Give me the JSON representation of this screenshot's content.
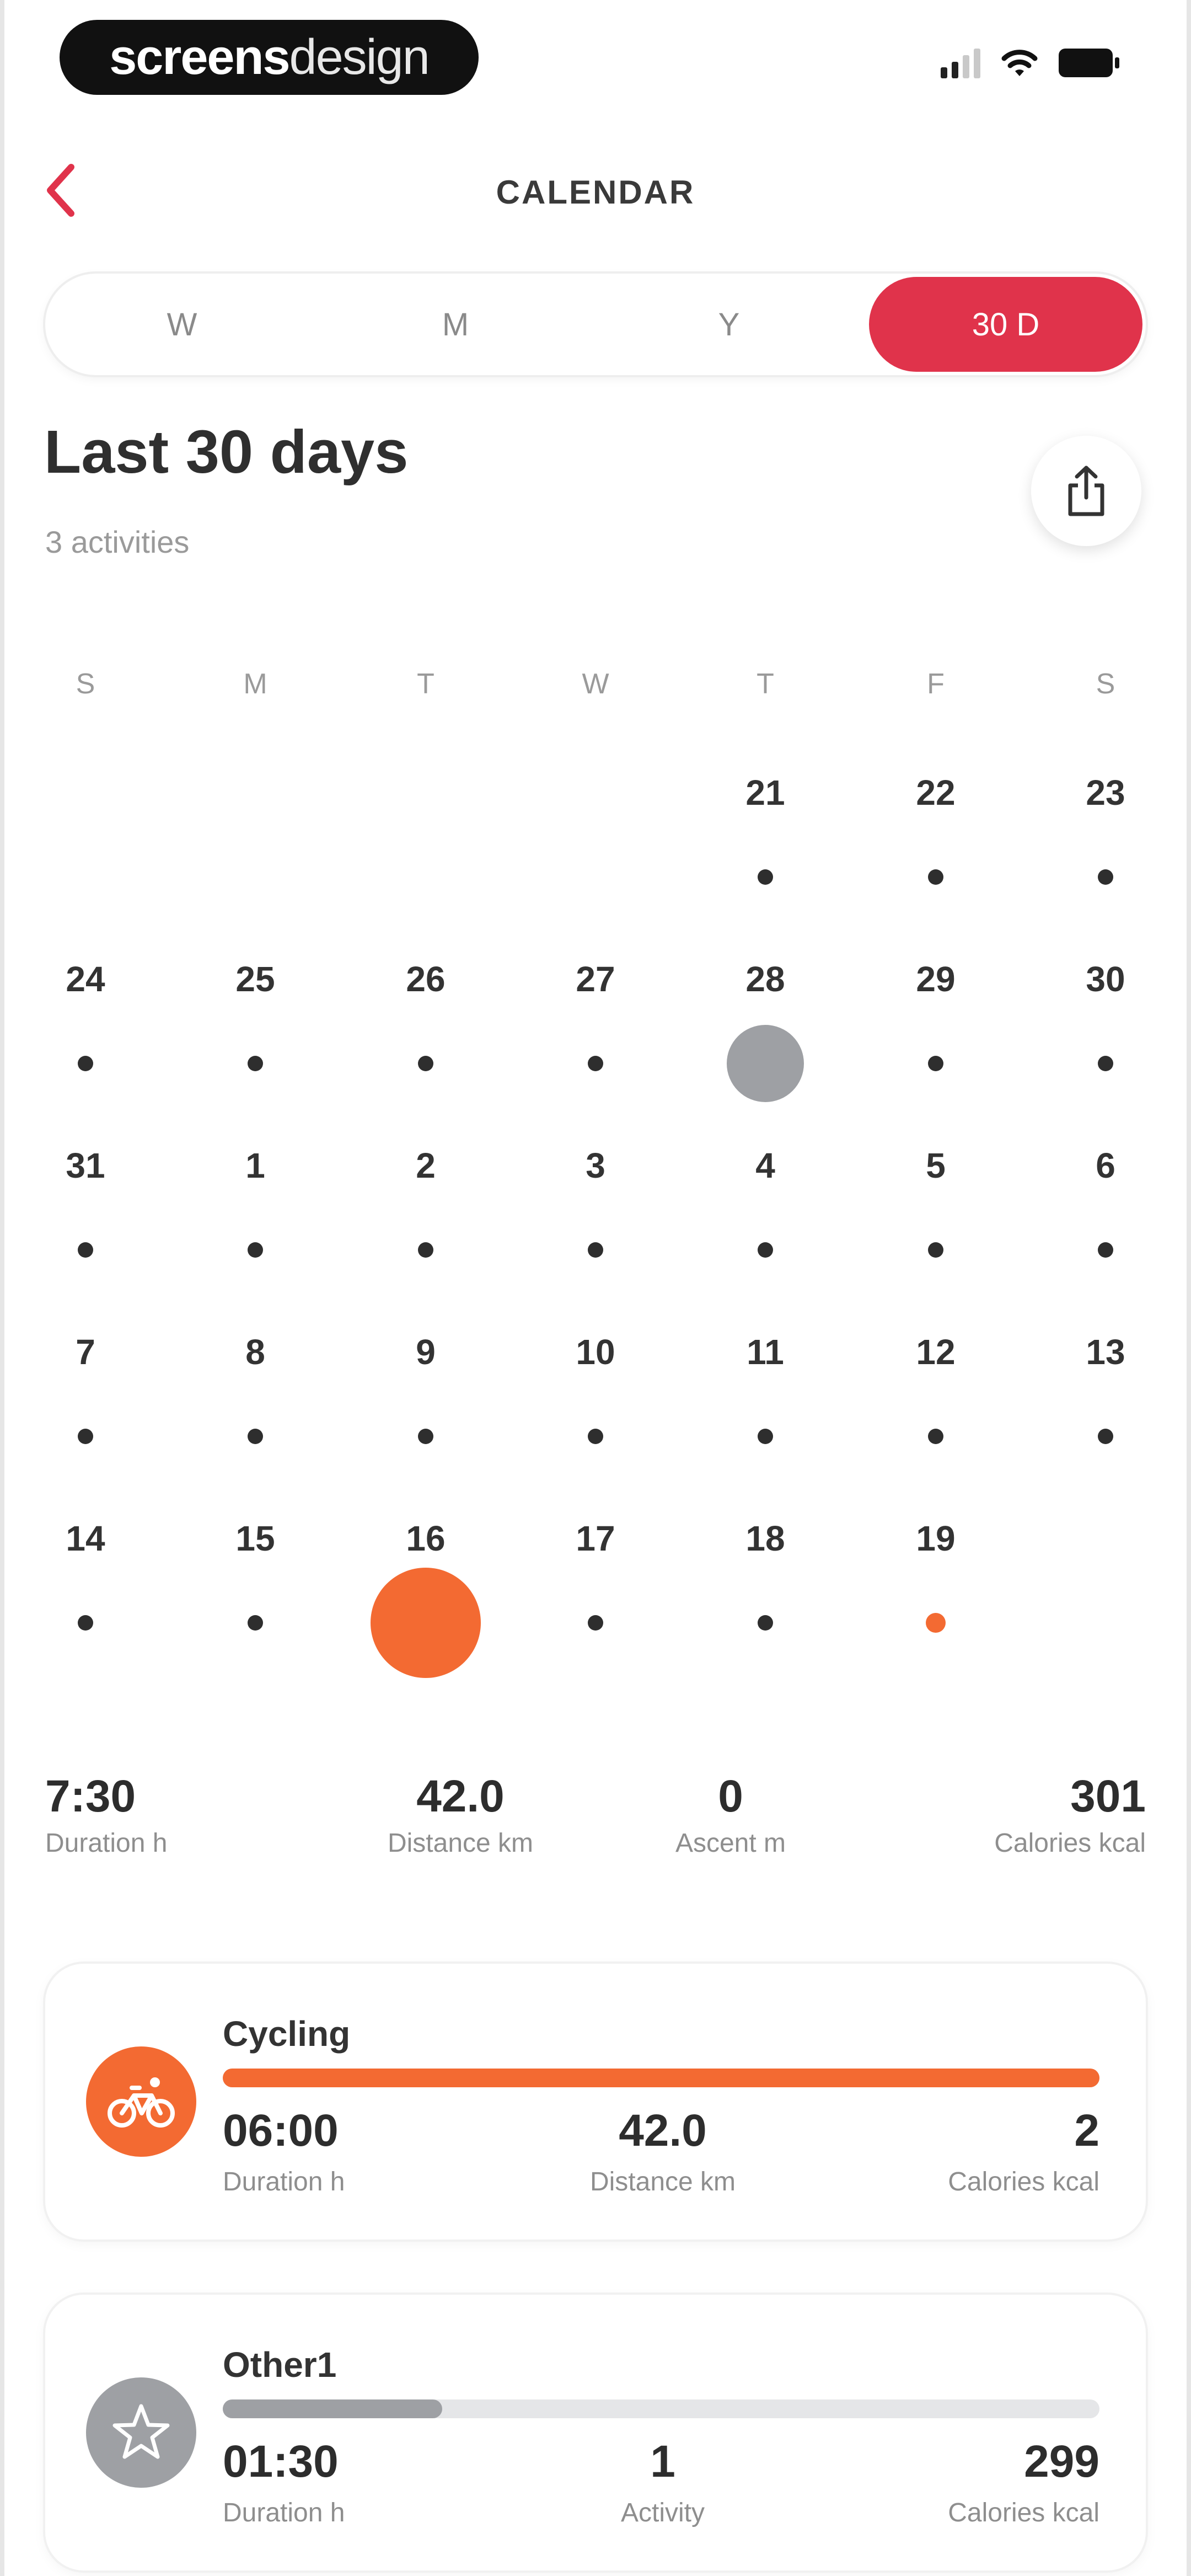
{
  "status_bar": {
    "brand_bold": "screens",
    "brand_light": "design"
  },
  "header": {
    "title": "CALENDAR",
    "back_icon": "chevron-left-icon"
  },
  "tabs": [
    {
      "label": "W",
      "active": false
    },
    {
      "label": "M",
      "active": false
    },
    {
      "label": "Y",
      "active": false
    },
    {
      "label": "30 D",
      "active": true
    }
  ],
  "summary": {
    "title": "Last 30 days",
    "subtitle": "3 activities",
    "share_icon": "share-icon"
  },
  "calendar": {
    "weekdays": [
      "S",
      "M",
      "T",
      "W",
      "T",
      "F",
      "S"
    ],
    "weeks": [
      [
        null,
        null,
        null,
        null,
        {
          "day": "21"
        },
        {
          "day": "22"
        },
        {
          "day": "23"
        }
      ],
      [
        {
          "day": "24"
        },
        {
          "day": "25"
        },
        {
          "day": "26"
        },
        {
          "day": "27"
        },
        {
          "day": "28",
          "marker": "big-grey"
        },
        {
          "day": "29"
        },
        {
          "day": "30"
        }
      ],
      [
        {
          "day": "31"
        },
        {
          "day": "1"
        },
        {
          "day": "2"
        },
        {
          "day": "3"
        },
        {
          "day": "4"
        },
        {
          "day": "5"
        },
        {
          "day": "6"
        }
      ],
      [
        {
          "day": "7"
        },
        {
          "day": "8"
        },
        {
          "day": "9"
        },
        {
          "day": "10"
        },
        {
          "day": "11"
        },
        {
          "day": "12"
        },
        {
          "day": "13"
        }
      ],
      [
        {
          "day": "14"
        },
        {
          "day": "15"
        },
        {
          "day": "16",
          "marker": "big-orange"
        },
        {
          "day": "17"
        },
        {
          "day": "18"
        },
        {
          "day": "19",
          "marker": "small-orange"
        },
        null
      ]
    ]
  },
  "totals": [
    {
      "value": "7:30",
      "label": "Duration h"
    },
    {
      "value": "42.0",
      "label": "Distance km"
    },
    {
      "value": "0",
      "label": "Ascent m"
    },
    {
      "value": "301",
      "label": "Calories kcal"
    }
  ],
  "activities": [
    {
      "name": "Cycling",
      "icon": "bicycle-icon",
      "color": "#f36a32",
      "bar_fraction": 1.0,
      "stats": [
        {
          "value": "06:00",
          "label": "Duration h"
        },
        {
          "value": "42.0",
          "label": "Distance km"
        },
        {
          "value": "2",
          "label": "Calories kcal"
        }
      ]
    },
    {
      "name": "Other1",
      "icon": "star-icon",
      "color": "#9ea0a4",
      "bar_fraction": 0.25,
      "stats": [
        {
          "value": "01:30",
          "label": "Duration h"
        },
        {
          "value": "1",
          "label": "Activity"
        },
        {
          "value": "299",
          "label": "Calories kcal"
        }
      ]
    }
  ]
}
